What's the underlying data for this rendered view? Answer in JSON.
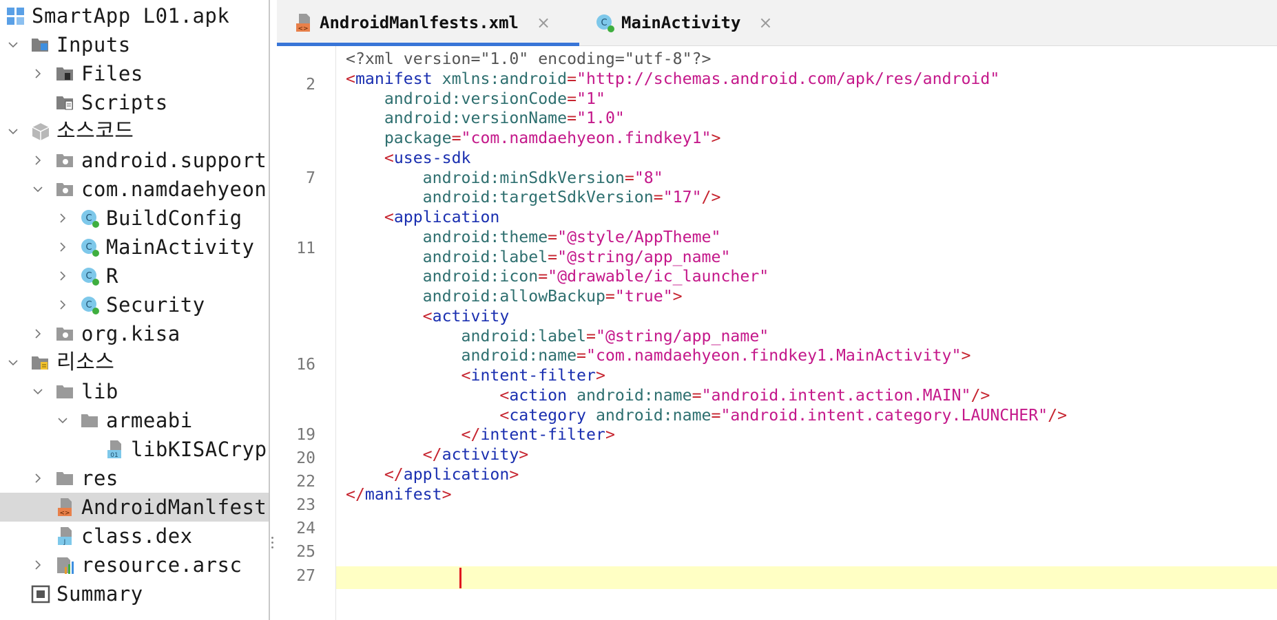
{
  "tree": [
    {
      "label": "SmartApp L01.apk",
      "expand": "none",
      "icon": "apk-icon"
    },
    {
      "label": "Inputs",
      "expand": "expanded",
      "icon": "inputs-folder-icon"
    },
    {
      "label": "Files",
      "expand": "collapsed",
      "icon": "files-folder-icon"
    },
    {
      "label": "Scripts",
      "expand": "none",
      "icon": "scripts-folder-icon"
    },
    {
      "label": "소스코드",
      "expand": "expanded",
      "icon": "package-icon"
    },
    {
      "label": "android.support",
      "expand": "collapsed",
      "icon": "package-folder-icon"
    },
    {
      "label": "com.namdaehyeon",
      "expand": "expanded",
      "icon": "package-folder-icon"
    },
    {
      "label": "BuildConfig",
      "expand": "collapsed",
      "icon": "class-icon"
    },
    {
      "label": "MainActivity",
      "expand": "collapsed",
      "icon": "class-icon"
    },
    {
      "label": "R",
      "expand": "collapsed",
      "icon": "class-icon"
    },
    {
      "label": "Security",
      "expand": "collapsed",
      "icon": "class-icon"
    },
    {
      "label": "org.kisa",
      "expand": "collapsed",
      "icon": "package-folder-icon"
    },
    {
      "label": "리소스",
      "expand": "expanded",
      "icon": "resources-folder-icon"
    },
    {
      "label": "lib",
      "expand": "expanded",
      "icon": "folder-icon"
    },
    {
      "label": "armeabi",
      "expand": "expanded",
      "icon": "folder-icon"
    },
    {
      "label": "libKISACryp",
      "expand": "none",
      "icon": "binary-file-icon"
    },
    {
      "label": "res",
      "expand": "collapsed",
      "icon": "folder-icon"
    },
    {
      "label": "AndroidManlfest",
      "expand": "none",
      "icon": "xml-file-icon"
    },
    {
      "label": "class.dex",
      "expand": "none",
      "icon": "dex-file-icon"
    },
    {
      "label": "resource.arsc",
      "expand": "collapsed",
      "icon": "arsc-file-icon"
    },
    {
      "label": "Summary",
      "expand": "none",
      "icon": "summary-icon"
    }
  ],
  "selected_tree_item": "AndroidManlfest",
  "tabs": [
    {
      "label": "AndroidManlfests.xml",
      "close": "×",
      "icon": "xml-file-icon",
      "active": true
    },
    {
      "label": "MainActivity",
      "close": "×",
      "icon": "class-icon",
      "active": false
    }
  ],
  "line_numbers": [
    "2",
    "7",
    "11",
    "16",
    "19",
    "20",
    "22",
    "23",
    "24",
    "25",
    "27"
  ],
  "code": [
    {
      "tokens": [
        [
          "decl",
          "<?xml version=\"1.0\" encoding=\"utf-8\"?>"
        ]
      ]
    },
    {
      "tokens": [
        [
          "punct",
          "<"
        ],
        [
          "tag",
          "manifest "
        ],
        [
          "attr",
          "xmlns:android"
        ],
        [
          "punct",
          "="
        ],
        [
          "val",
          "\"http://schemas.android.com/apk/res/android\""
        ]
      ]
    },
    {
      "tokens": [
        [
          "attr",
          "    android:versionCode"
        ],
        [
          "punct",
          "="
        ],
        [
          "val",
          "\"1\""
        ]
      ]
    },
    {
      "tokens": [
        [
          "attr",
          "    android:versionName"
        ],
        [
          "punct",
          "="
        ],
        [
          "val",
          "\"1.0\""
        ]
      ]
    },
    {
      "tokens": [
        [
          "attr",
          "    package"
        ],
        [
          "punct",
          "="
        ],
        [
          "val",
          "\"com.namdaehyeon.findkey1\""
        ],
        [
          "punct",
          ">"
        ]
      ]
    },
    {
      "tokens": [
        [
          "punct",
          "    <"
        ],
        [
          "tag",
          "uses-sdk"
        ]
      ]
    },
    {
      "tokens": [
        [
          "attr",
          "        android:minSdkVersion"
        ],
        [
          "punct",
          "="
        ],
        [
          "val",
          "\"8\""
        ]
      ]
    },
    {
      "tokens": [
        [
          "attr",
          "        android:targetSdkVersion"
        ],
        [
          "punct",
          "="
        ],
        [
          "val",
          "\"17\""
        ],
        [
          "punct",
          "/>"
        ]
      ]
    },
    {
      "tokens": [
        [
          "punct",
          "    <"
        ],
        [
          "tag",
          "application"
        ]
      ]
    },
    {
      "tokens": [
        [
          "attr",
          "        android:theme"
        ],
        [
          "punct",
          "="
        ],
        [
          "val",
          "\"@style/AppTheme\""
        ]
      ]
    },
    {
      "tokens": [
        [
          "attr",
          "        android:label"
        ],
        [
          "punct",
          "="
        ],
        [
          "val",
          "\"@string/app_name\""
        ]
      ]
    },
    {
      "tokens": [
        [
          "attr",
          "        android:icon"
        ],
        [
          "punct",
          "="
        ],
        [
          "val",
          "\"@drawable/ic_launcher\""
        ]
      ]
    },
    {
      "tokens": [
        [
          "attr",
          "        android:allowBackup"
        ],
        [
          "punct",
          "="
        ],
        [
          "val",
          "\"true\""
        ],
        [
          "punct",
          ">"
        ]
      ]
    },
    {
      "tokens": [
        [
          "punct",
          "        <"
        ],
        [
          "tag",
          "activity"
        ]
      ]
    },
    {
      "tokens": [
        [
          "attr",
          "            android:label"
        ],
        [
          "punct",
          "="
        ],
        [
          "val",
          "\"@string/app_name\""
        ]
      ]
    },
    {
      "tokens": [
        [
          "attr",
          "            android:name"
        ],
        [
          "punct",
          "="
        ],
        [
          "val",
          "\"com.namdaehyeon.findkey1.MainActivity\""
        ],
        [
          "punct",
          ">"
        ]
      ]
    },
    {
      "tokens": [
        [
          "punct",
          "            <"
        ],
        [
          "tag",
          "intent-filter"
        ],
        [
          "punct",
          ">"
        ]
      ]
    },
    {
      "tokens": [
        [
          "punct",
          "                <"
        ],
        [
          "tag",
          "action "
        ],
        [
          "attr",
          "android:name"
        ],
        [
          "punct",
          "="
        ],
        [
          "val",
          "\"android.intent.action.MAIN\""
        ],
        [
          "punct",
          "/>"
        ]
      ]
    },
    {
      "tokens": [
        [
          "punct",
          "                <"
        ],
        [
          "tag",
          "category "
        ],
        [
          "attr",
          "android:name"
        ],
        [
          "punct",
          "="
        ],
        [
          "val",
          "\"android.intent.category.LAUNCHER\""
        ],
        [
          "punct",
          "/>"
        ]
      ]
    },
    {
      "tokens": [
        [
          "punct",
          "            </"
        ],
        [
          "tag",
          "intent-filter"
        ],
        [
          "punct",
          ">"
        ]
      ]
    },
    {
      "tokens": [
        [
          "punct",
          "        </"
        ],
        [
          "tag",
          "activity"
        ],
        [
          "punct",
          ">"
        ]
      ]
    },
    {
      "tokens": [
        [
          "punct",
          "    </"
        ],
        [
          "tag",
          "application"
        ],
        [
          "punct",
          ">"
        ]
      ]
    },
    {
      "tokens": [
        [
          "punct",
          "</"
        ],
        [
          "tag",
          "manifest"
        ],
        [
          "punct",
          ">"
        ]
      ]
    }
  ],
  "colors": {
    "punct": "#c6242f",
    "tag": "#1a2fb0",
    "attr": "#2e6f6f",
    "val": "#c4188a",
    "decl": "#555555",
    "current_line": "#ffffc4",
    "caret": "#e0141e",
    "tab_accent": "#3875d7",
    "selection": "#d9d9d9"
  }
}
